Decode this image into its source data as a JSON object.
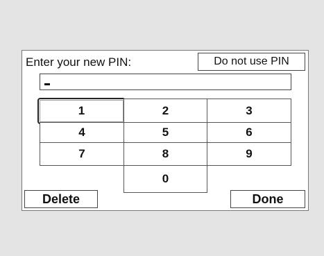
{
  "dialog": {
    "prompt": "Enter your new PIN:",
    "no_pin_label": "Do not use PIN",
    "pin_value": ""
  },
  "keypad": {
    "keys": [
      "1",
      "2",
      "3",
      "4",
      "5",
      "6",
      "7",
      "8",
      "9",
      "0"
    ],
    "selected_key": "1"
  },
  "actions": {
    "delete_label": "Delete",
    "done_label": "Done"
  }
}
